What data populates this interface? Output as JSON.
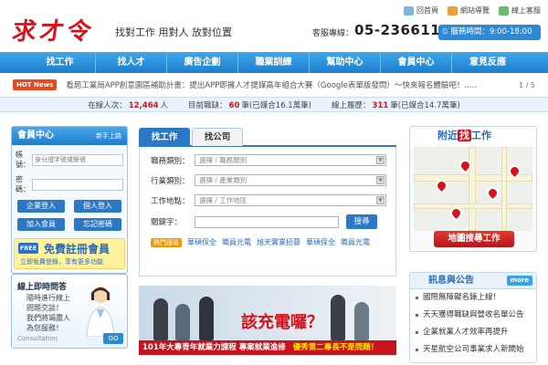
{
  "header": {
    "logo": "求才令",
    "slogan": "找對工作 用對人 放對位置",
    "toplinks": [
      "回首頁",
      "網站導覽",
      "線上客服"
    ],
    "hotline_label": "客服專線：",
    "phone": "05-2366111",
    "service_hours": "服務時間：9:00-18:00"
  },
  "nav": [
    "找工作",
    "找人才",
    "廣告企劃",
    "職業訓練",
    "幫助中心",
    "會員中心",
    "意見反應"
  ],
  "ticker": {
    "badge": "HOT News",
    "text": "看屆工業局APP創意園區補助計畫：提出APP即擁人才提媒高年組合大賽（Google表單版發問）～快來報名體驗吧！.....",
    "page": "1 / 5"
  },
  "stats": {
    "online_label": "在線人次：",
    "online_value": "12,464",
    "online_unit": "人",
    "openings_label": "目前職缺：",
    "openings_value": "60",
    "openings_unit": "筆(已媒合16.1萬筆)",
    "resumes_label": "線上履歷：",
    "resumes_value": "311",
    "resumes_unit": "筆(已媒合14.7萬筆)"
  },
  "member": {
    "title": "會員中心",
    "newbie": "新手上路",
    "account_label": "帳號：",
    "account_placeholder": "身分證字號或帳號",
    "password_label": "密碼：",
    "buttons": [
      "企業登入",
      "個人登入",
      "加入會員",
      "忘記密碼"
    ],
    "free_tag": "FREE",
    "free_big": "免費註冊會員",
    "free_small": "立即免費登錄，享有更多功能"
  },
  "cs": {
    "title": "線上即時問答",
    "desc": [
      "隨時進行線上",
      "問題交談！",
      "我們將竭盡人",
      "為您服務！"
    ],
    "en": "Consultation",
    "go": "GO"
  },
  "search": {
    "tabs": [
      "找工作",
      "找公司"
    ],
    "rows": [
      {
        "label": "職務類別：",
        "placeholder": "選擇 / 職務類別"
      },
      {
        "label": "行業類別：",
        "placeholder": "選擇 / 產業類別"
      },
      {
        "label": "工作地點：",
        "placeholder": "選擇 / 工作地區"
      }
    ],
    "keyword_label": "關鍵字：",
    "button": "搜尋",
    "hot_label": "熱門搜尋",
    "hot_terms": [
      "華碩保全",
      "職員光電",
      "旭天實業招募",
      "華碩保全",
      "職員光電"
    ]
  },
  "banner": {
    "headline": "該充電囉？",
    "bottom": "101年大專青年就業力課程 專案就業進修",
    "bottom_yellow": "優秀第二專長不是問題！"
  },
  "map": {
    "title_pre": "附近",
    "title_mid": "找",
    "title_post": "工作",
    "button": "地圖搜尋工作",
    "pins": [
      "徵",
      "徵",
      "徵",
      "徵",
      "徵"
    ]
  },
  "news": {
    "title": "訊息與公告",
    "more": "more",
    "items": [
      "國際無障礙名錄上線！",
      "天天獲得職缺與營收名單公告",
      "企業就業人才效率再提升",
      "天星航空公司事業求人新開始"
    ]
  }
}
